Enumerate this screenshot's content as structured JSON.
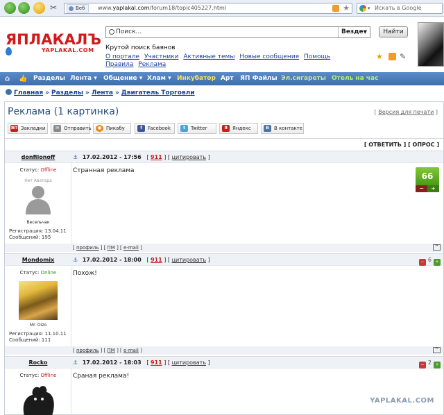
{
  "browser": {
    "site_badge": "Веб",
    "url_prefix": "www.",
    "url_domain": "yaplakal.com",
    "url_path": "/forum18/topic405227.html",
    "search_placeholder": "Искать в Google"
  },
  "header": {
    "logo_text": "ЯПЛАКАЛЪ",
    "logo_sub": "YAPLAKAL.COM",
    "search_placeholder": "Поиск...",
    "search_scope": "Везде",
    "find_label": "Найти",
    "tagline": "Крутой поиск баянов",
    "links": [
      "О портале",
      "Участники",
      "Активные темы",
      "Новые сообщения",
      "Помощь",
      "Правила",
      "Реклама"
    ]
  },
  "nav": {
    "items": [
      {
        "label": "Разделы",
        "color": "#ffffff"
      },
      {
        "label": "Лента ▾",
        "color": "#ffffff"
      },
      {
        "label": "Общение ▾",
        "color": "#ffffff"
      },
      {
        "label": "Хлам ▾",
        "color": "#ffffff"
      },
      {
        "label": "Инкубатор",
        "color": "#ffe35a"
      },
      {
        "label": "Арт",
        "color": "#ffffff"
      },
      {
        "label": "ЯП Файлы",
        "color": "#ffffff"
      },
      {
        "label": "Эл.сигареты",
        "color": "#c9e3a0"
      },
      {
        "label": "Отель на час",
        "color": "#b6f06a"
      }
    ]
  },
  "breadcrumb": [
    "Главная",
    "Разделы",
    "Лента",
    "Двигатель Торговли"
  ],
  "topic": {
    "title": "Реклама (1 картинка)",
    "print_link": "Версия для печати",
    "share": [
      {
        "label": "Закладки",
        "icon": "yap-icon",
        "color": "#d11a1a",
        "glyph": "ЯП"
      },
      {
        "label": "Отправить",
        "icon": "mail-icon",
        "color": "#8a8a8a",
        "glyph": "✉"
      },
      {
        "label": "Пикабу",
        "icon": "pikabu-icon",
        "color": "#e88a1a",
        "glyph": "●"
      },
      {
        "label": "Facebook",
        "icon": "facebook-icon",
        "color": "#3b5998",
        "glyph": "f"
      },
      {
        "label": "Twitter",
        "icon": "twitter-icon",
        "color": "#4aa3df",
        "glyph": "t"
      },
      {
        "label": "Яндекс",
        "icon": "yandex-icon",
        "color": "#d11a1a",
        "glyph": "Я"
      },
      {
        "label": "В контакте",
        "icon": "vk-icon",
        "color": "#4a76a8",
        "glyph": "B"
      }
    ],
    "reply_label": "[ ОТВЕТИТЬ ]",
    "poll_label": "[ ОПРОС ]"
  },
  "posts": [
    {
      "user": "donfilonoff",
      "date": "17.02.2012 - 17:56",
      "num": "911",
      "cite": "цитировать",
      "status_label": "Статус:",
      "status": "Offline",
      "online": false,
      "avatar_label": "Нет Аватара",
      "avatar_name": "Весельчак",
      "reg": "Регистрация: 13.04.11",
      "msgs": "Сообщений: 195",
      "text": "Странная реклама",
      "rating": "66"
    },
    {
      "user": "Mondomix",
      "date": "17.02.2012 - 18:00",
      "num": "911",
      "cite": "цитировать",
      "status_label": "Статус:",
      "status": "Online",
      "online": true,
      "avatar_name": "Mr. Oizo",
      "reg": "Регистрация: 11.10.11",
      "msgs": "Сообщений: 111",
      "text": "Похож!",
      "rating": "6"
    },
    {
      "user": "Rocko",
      "date": "17.02.2012 - 18:03",
      "num": "911",
      "cite": "цитировать",
      "status_label": "Статус:",
      "status": "Offline",
      "online": false,
      "text": "Сраная реклама!",
      "rating": "2"
    }
  ],
  "post_footer": {
    "profile": "профиль",
    "pm": "ПМ",
    "email": "e-mail"
  },
  "watermark": "YAPLAKAL.COM"
}
